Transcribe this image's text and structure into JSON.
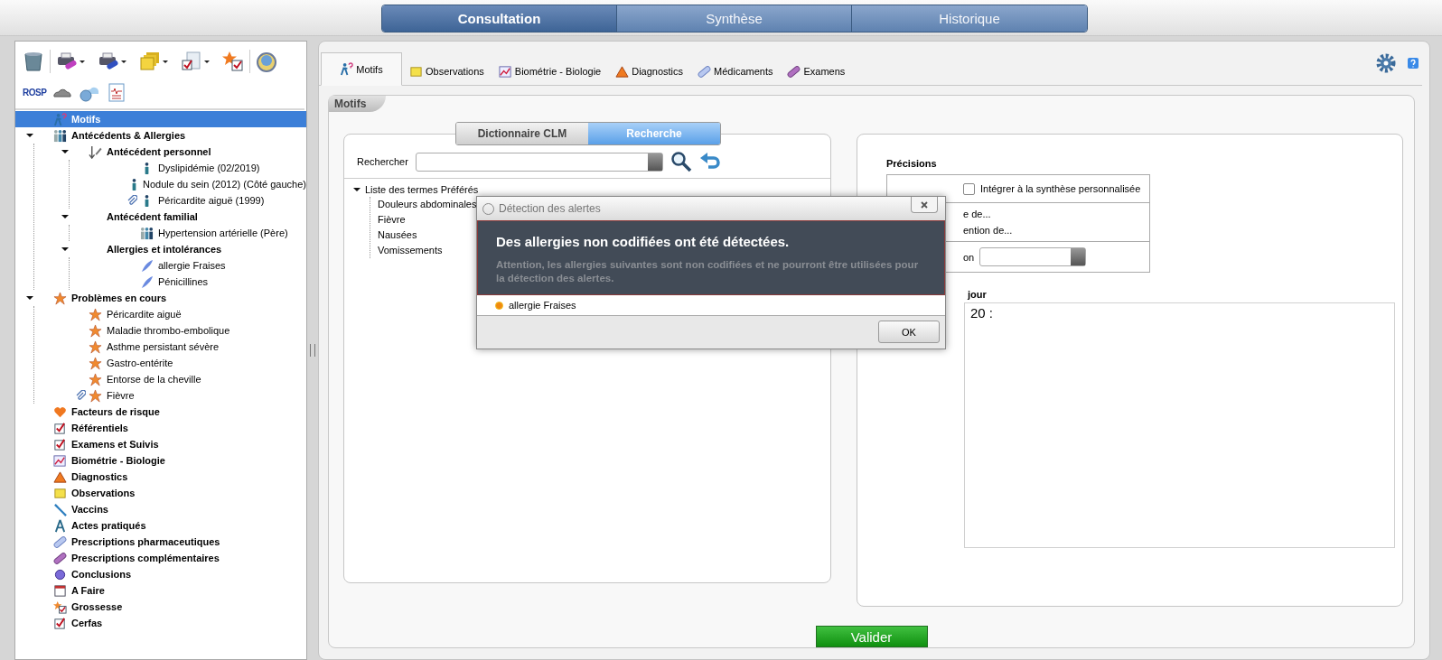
{
  "main_tabs": [
    {
      "label": "Consultation",
      "selected": true
    },
    {
      "label": "Synthèse",
      "selected": false
    },
    {
      "label": "Historique",
      "selected": false
    }
  ],
  "toolbar": {
    "rosp_label": "ROSP"
  },
  "tree": {
    "items": [
      {
        "label": "Motifs",
        "selected": true
      },
      {
        "label": "Antécédents & Allergies",
        "selected": false,
        "expanded": true,
        "children": [
          {
            "label": "Antécédent personnel",
            "selected": false,
            "expanded": true,
            "children": [
              {
                "label": "Dyslipidémie (02/2019)",
                "selected": false,
                "attachment": false
              },
              {
                "label": "Nodule du sein (2012)  (Côté gauche)",
                "selected": false,
                "attachment": false
              },
              {
                "label": "Péricardite aiguë (1999)",
                "selected": false,
                "attachment": true
              }
            ]
          },
          {
            "label": "Antécédent familial",
            "selected": false,
            "expanded": true,
            "children": [
              {
                "label": "Hypertension artérielle (Père)",
                "selected": false
              }
            ]
          },
          {
            "label": "Allergies et intolérances",
            "selected": false,
            "expanded": true,
            "children": [
              {
                "label": "allergie Fraises",
                "selected": false
              },
              {
                "label": "Pénicillines",
                "selected": false
              }
            ]
          }
        ]
      },
      {
        "label": "Problèmes en cours",
        "selected": false,
        "expanded": true,
        "children": [
          {
            "label": "Péricardite aiguë",
            "selected": false,
            "attachment": false
          },
          {
            "label": "Maladie thrombo-embolique",
            "selected": false,
            "attachment": false
          },
          {
            "label": "Asthme persistant sévère",
            "selected": false,
            "attachment": false
          },
          {
            "label": "Gastro-entérite",
            "selected": false,
            "attachment": false
          },
          {
            "label": "Entorse de la cheville",
            "selected": false,
            "attachment": false
          },
          {
            "label": "Fièvre",
            "selected": false,
            "attachment": true
          }
        ]
      },
      {
        "label": "Facteurs de risque",
        "selected": false
      },
      {
        "label": "Référentiels",
        "selected": false
      },
      {
        "label": "Examens et Suivis",
        "selected": false
      },
      {
        "label": "Biométrie - Biologie",
        "selected": false
      },
      {
        "label": "Diagnostics",
        "selected": false
      },
      {
        "label": "Observations",
        "selected": false
      },
      {
        "label": "Vaccins",
        "selected": false
      },
      {
        "label": "Actes pratiqués",
        "selected": false
      },
      {
        "label": "Prescriptions pharmaceutiques",
        "selected": false
      },
      {
        "label": "Prescriptions complémentaires",
        "selected": false
      },
      {
        "label": "Conclusions",
        "selected": false
      },
      {
        "label": "A Faire",
        "selected": false
      },
      {
        "label": "Grossesse",
        "selected": false
      },
      {
        "label": "Cerfas",
        "selected": false
      }
    ]
  },
  "section_tabs": [
    {
      "label": "Motifs",
      "selected": true
    },
    {
      "label": "Observations",
      "selected": false
    },
    {
      "label": "Biométrie - Biologie",
      "selected": false
    },
    {
      "label": "Diagnostics",
      "selected": false
    },
    {
      "label": "Médicaments",
      "selected": false
    },
    {
      "label": "Examens",
      "selected": false
    }
  ],
  "panel_title": "Motifs",
  "search_panel": {
    "modes": [
      {
        "label": "Dictionnaire CLM",
        "selected": false
      },
      {
        "label": "Recherche",
        "selected": true
      }
    ],
    "search_label": "Rechercher",
    "terms": {
      "label": "Liste des termes Préférés",
      "expanded": true,
      "children": [
        "Douleurs abdominales",
        "Fièvre",
        "Nausées",
        "Vomissements"
      ]
    }
  },
  "details": {
    "heading": "Précisions",
    "integrate": {
      "label": "Intégrer à la synthèse personnalisée",
      "checked": false
    },
    "options": [
      "e de...",
      "ention de..."
    ],
    "select_label": "on",
    "reason_heading": "jour",
    "reason_text": "20 :"
  },
  "validate_button": "Valider",
  "dialog": {
    "title": "Détection des alertes",
    "headline": "Des allergies non codifiées ont été détectées.",
    "message": "Attention, les allergies suivantes sont non codifiées et ne pourront être utilisées pour la détection des alertes.",
    "items": [
      "allergie Fraises"
    ],
    "ok": "OK"
  }
}
